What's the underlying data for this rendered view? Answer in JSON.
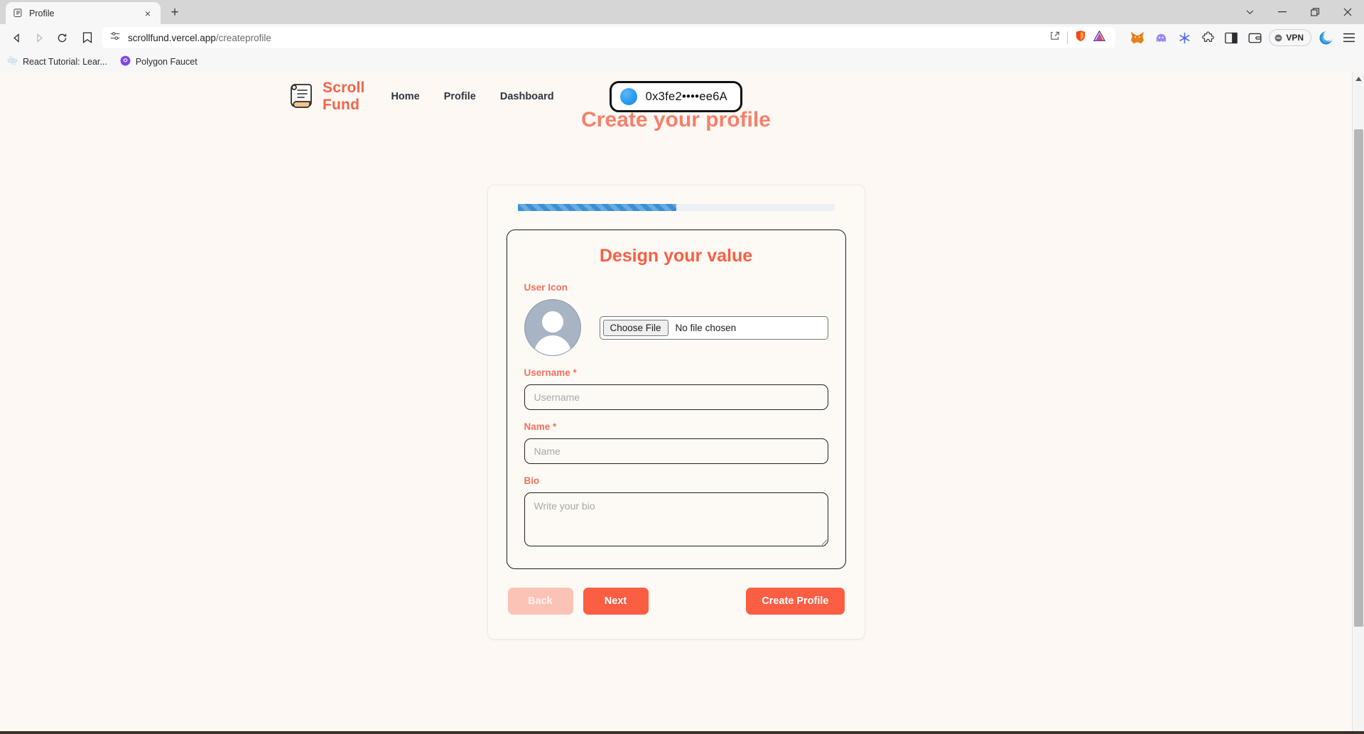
{
  "browser": {
    "tab": {
      "title": "Profile",
      "favicon_icon": "scroll-icon",
      "close_icon": "×"
    },
    "new_tab_label": "+",
    "window_controls": [
      {
        "name": "tab-search",
        "glyph": "⌄"
      },
      {
        "name": "minimize",
        "glyph": "—"
      },
      {
        "name": "maximize",
        "glyph": "❐"
      },
      {
        "name": "close",
        "glyph": "✕"
      }
    ],
    "nav": {
      "back_icon": "◁",
      "forward_icon": "▷",
      "reload_icon": "⟳"
    },
    "url": {
      "prefix": "scrollfund.vercel.app",
      "path": "/createprofile",
      "full": "scrollfund.vercel.app/createprofile"
    },
    "url_right_icons": [
      "share-icon",
      "brave-shield-icon",
      "brave-rewards-icon"
    ],
    "extensions": [
      "metamask-icon",
      "phantom-wallet-icon",
      "snowflake-icon",
      "puzzle-extensions-icon",
      "sidebar-icon",
      "wallet-icon"
    ],
    "vpn_label": "VPN",
    "profile_icon": "brave-profile-icon",
    "menu_icon": "hamburger-menu-icon",
    "bookmarks": [
      {
        "label": "React Tutorial: Lear...",
        "icon": "react-favicon"
      },
      {
        "label": "Polygon Faucet",
        "icon": "polygon-favicon"
      }
    ]
  },
  "site": {
    "brand": {
      "name": "Scroll Fund",
      "logo_icon": "scroll-icon"
    },
    "nav_links": [
      {
        "label": "Home"
      },
      {
        "label": "Profile"
      },
      {
        "label": "Dashboard"
      }
    ],
    "wallet": {
      "address": "0x3fe2••••ee6A",
      "avatar_icon": "wallet-blob-icon"
    }
  },
  "page": {
    "title": "Create your profile",
    "progress": {
      "percent": 50
    },
    "step": {
      "title": "Design your value",
      "fields": {
        "user_icon": {
          "label": "User Icon",
          "avatar_icon": "default-user-avatar-icon",
          "file_button_label": "Choose File",
          "file_status": "No file chosen"
        },
        "username": {
          "label": "Username *",
          "value": "",
          "placeholder": "Username"
        },
        "name": {
          "label": "Name *",
          "value": "",
          "placeholder": "Name"
        },
        "bio": {
          "label": "Bio",
          "value": "",
          "placeholder": "Write your bio"
        }
      }
    },
    "actions": {
      "back": "Back",
      "next": "Next",
      "create": "Create Profile"
    }
  },
  "colors": {
    "page_bg": "#fdf8f3",
    "brand": "#f4634b",
    "accent": "#fb5e43",
    "accent_soft": "#fbc3b6",
    "title": "#f5806d",
    "progress": "#3d8fd4"
  }
}
